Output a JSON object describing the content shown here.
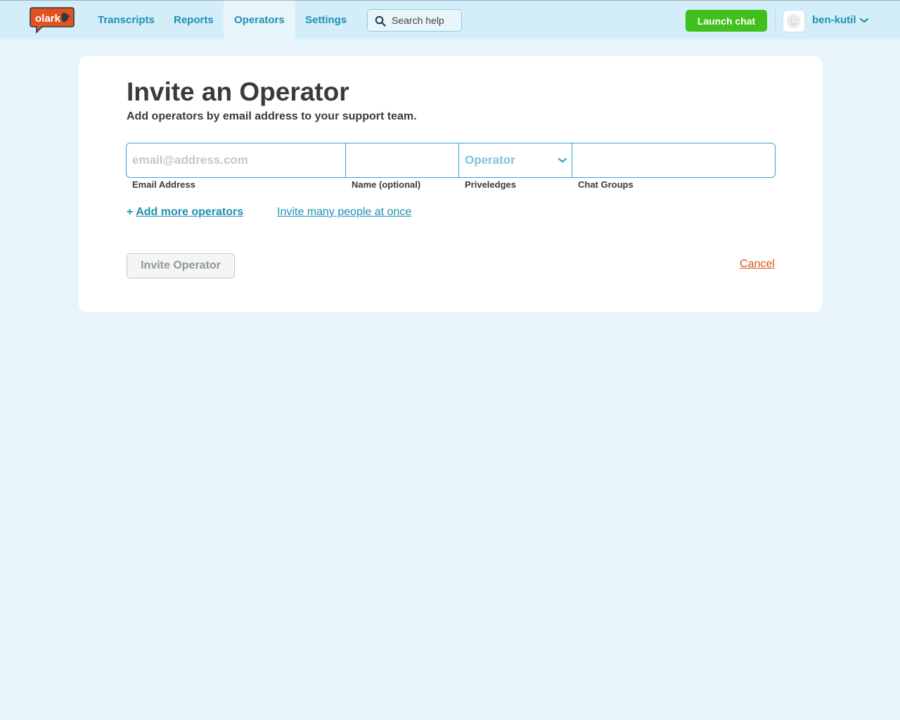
{
  "brand": {
    "logo_text": "olark",
    "accent": "#1f8fb3",
    "logo_color": "#e0531f"
  },
  "nav": {
    "items": [
      {
        "label": "Transcripts",
        "active": false
      },
      {
        "label": "Reports",
        "active": false
      },
      {
        "label": "Operators",
        "active": true
      },
      {
        "label": "Settings",
        "active": false
      }
    ],
    "search": {
      "placeholder": "Search help",
      "icon": "search-icon"
    },
    "launch_label": "Launch chat",
    "user": {
      "name": "ben-kutil",
      "icon": "chevron-down-icon"
    }
  },
  "page": {
    "title": "Invite an Operator",
    "subtitle": "Add operators by email address to your support team."
  },
  "form": {
    "email": {
      "label": "Email Address",
      "placeholder": "email@address.com",
      "value": ""
    },
    "name": {
      "label": "Name (optional)",
      "value": ""
    },
    "privileges": {
      "label": "Priveledges",
      "selected": "Operator"
    },
    "groups": {
      "label": "Chat Groups",
      "value": ""
    }
  },
  "actions": {
    "add_more_prefix": "+",
    "add_more_label": "Add more operators",
    "invite_many_label": "Invite many people at once",
    "invite_button_label": "Invite Operator",
    "cancel_label": "Cancel"
  }
}
